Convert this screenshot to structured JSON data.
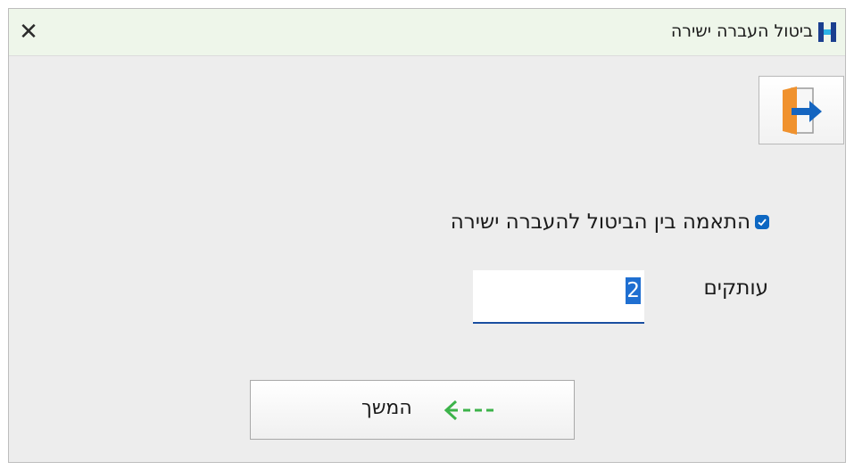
{
  "window": {
    "title": "ביטול העברה ישירה",
    "close_glyph": "✕"
  },
  "icons": {
    "app": "app-logo-icon",
    "exit": "exit-door-icon",
    "arrow": "arrow-left-icon",
    "check": "check-icon"
  },
  "form": {
    "match_checkbox_label": "התאמה בין הביטול להעברה ישירה",
    "match_checked": true,
    "copies_label": "עותקים",
    "copies_value": "2"
  },
  "buttons": {
    "continue_label": "המשך"
  },
  "colors": {
    "titlebar_bg": "#eef6ea",
    "window_bg": "#ededed",
    "accent": "#0d67c2",
    "arrow_green": "#3cb34a",
    "door_orange": "#f0922e"
  }
}
